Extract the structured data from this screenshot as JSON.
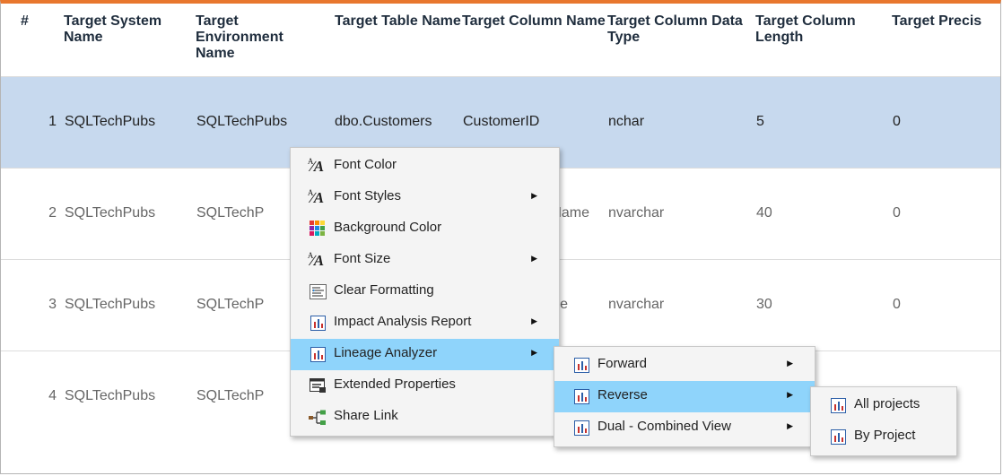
{
  "table": {
    "headers": [
      "#",
      "Target System Name",
      "Target Environment Name",
      "Target Table Name",
      "Target Column Name",
      "Target Column Data Type",
      "Target Column Length",
      "Target Precis"
    ],
    "rows": [
      [
        "1",
        "SQLTechPubs",
        "SQLTechPubs",
        "dbo.Customers",
        "CustomerID",
        "nchar",
        "5",
        "0"
      ],
      [
        "2",
        "SQLTechPubs",
        "SQLTechP",
        "",
        "nyName",
        "nvarchar",
        "40",
        "0"
      ],
      [
        "3",
        "SQLTechPubs",
        "SQLTechP",
        "",
        "tName",
        "nvarchar",
        "30",
        "0"
      ],
      [
        "4",
        "SQLTechPubs",
        "SQLTechP",
        "",
        "",
        "",
        "",
        ""
      ]
    ]
  },
  "context_menu": {
    "items": [
      {
        "label": "Font Color",
        "icon": "font-color-icon",
        "submenu": false
      },
      {
        "label": "Font Styles",
        "icon": "font-styles-icon",
        "submenu": true
      },
      {
        "label": "Background Color",
        "icon": "background-color-icon",
        "submenu": false
      },
      {
        "label": "Font Size",
        "icon": "font-size-icon",
        "submenu": true
      },
      {
        "label": "Clear Formatting",
        "icon": "clear-formatting-icon",
        "submenu": false
      },
      {
        "label": "Impact Analysis Report",
        "icon": "report-chart-icon",
        "submenu": true
      },
      {
        "label": "Lineage Analyzer",
        "icon": "report-chart-icon",
        "submenu": true,
        "highlighted": true
      },
      {
        "label": "Extended Properties",
        "icon": "extended-properties-icon",
        "submenu": false
      },
      {
        "label": "Share Link",
        "icon": "share-link-icon",
        "submenu": false
      }
    ]
  },
  "lineage_submenu": {
    "items": [
      {
        "label": "Forward",
        "icon": "report-chart-icon",
        "submenu": true
      },
      {
        "label": "Reverse",
        "icon": "report-chart-icon",
        "submenu": true,
        "highlighted": true
      },
      {
        "label": "Dual - Combined View",
        "icon": "report-chart-icon",
        "submenu": true
      }
    ]
  },
  "reverse_submenu": {
    "items": [
      {
        "label": "All projects",
        "icon": "report-chart-icon"
      },
      {
        "label": "By Project",
        "icon": "report-chart-icon"
      }
    ]
  },
  "colors": {
    "accent_top_border": "#e8772e",
    "selected_row": "#c7d9ee",
    "menu_highlight": "#8fd4fb"
  }
}
